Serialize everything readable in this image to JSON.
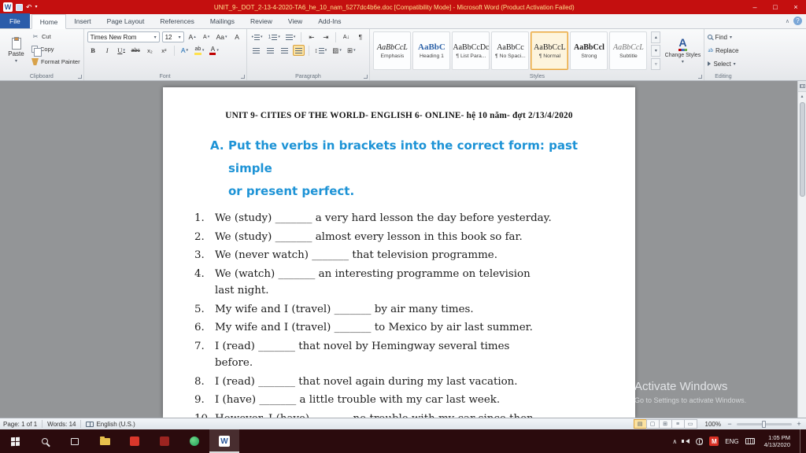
{
  "colors": {
    "titlebar": "#c40f0f",
    "taskbar": "#2b0b0d",
    "heading_blue": "#1d93d6",
    "file_tab_blue": "#2a5caa",
    "selection_orange": "#e8a33d",
    "doc_background": "#939597"
  },
  "icons": {
    "dropdown": "▾",
    "up_arrow": "▴",
    "down_arrow": "▾",
    "more_styles": "▿",
    "undo": "↶",
    "minimize": "–",
    "maximize": "□",
    "close": "×",
    "scissors": "✂",
    "pilcrow": "¶",
    "line_spacing": "↕",
    "shading": "▨",
    "borders": "⊞",
    "indent_decrease": "⇤",
    "indent_increase": "⇥",
    "sort": "A↓",
    "chevron_up": "∧",
    "help": "?",
    "view_print": "▤",
    "view_fullscreen": "▢",
    "view_web": "⊞",
    "view_outline": "≡",
    "view_draft": "▭",
    "zoom_out": "−",
    "zoom_in": "+",
    "spell_check": "✓"
  },
  "titlebar": {
    "title": "UNIT_9-_DOT_2-13-4-2020-TA6_he_10_nam_5277dc4b6e.doc [Compatibility Mode] - Microsoft Word (Product Activation Failed)"
  },
  "ribbon": {
    "tabs": [
      {
        "label": "File",
        "cls": "file"
      },
      {
        "label": "Home",
        "cls": "active"
      },
      {
        "label": "Insert"
      },
      {
        "label": "Page Layout"
      },
      {
        "label": "References"
      },
      {
        "label": "Mailings"
      },
      {
        "label": "Review"
      },
      {
        "label": "View"
      },
      {
        "label": "Add-Ins"
      }
    ],
    "clipboard": {
      "group_label": "Clipboard",
      "paste": "Paste",
      "cut": "Cut",
      "copy": "Copy",
      "format_painter": "Format Painter"
    },
    "font": {
      "group_label": "Font",
      "family": "Times New Rom",
      "size": "12",
      "grow": "A",
      "shrink": "A",
      "change_case": "Aa",
      "clear_formatting": "A",
      "bold": "B",
      "italic": "I",
      "underline": "U",
      "strike": "abc",
      "subscript": "x₂",
      "superscript": "x²",
      "effects": "A",
      "highlight": "ab",
      "font_color": "A"
    },
    "paragraph": {
      "group_label": "Paragraph"
    },
    "styles": {
      "group_label": "Styles",
      "gallery": [
        {
          "preview": "AaBbCcL",
          "name": "Emphasis",
          "cls": "italic"
        },
        {
          "preview": "AaBbC",
          "name": "Heading 1",
          "cls": "heading"
        },
        {
          "preview": "AaBbCcDc",
          "name": "¶ List Para..."
        },
        {
          "preview": "AaBbCc",
          "name": "¶ No Spaci..."
        },
        {
          "preview": "AaBbCcL",
          "name": "¶ Normal",
          "cls": "selected"
        },
        {
          "preview": "AaBbCcl",
          "name": "Strong",
          "cls": "bold"
        },
        {
          "preview": "AaBbCcL",
          "name": "Subtitle",
          "cls": "subtitle"
        }
      ],
      "change_styles": "Change Styles"
    },
    "editing": {
      "group_label": "Editing",
      "find": "Find",
      "replace": "Replace",
      "select": "Select"
    }
  },
  "document": {
    "header": "UNIT 9- CITIES OF THE WORLD- ENGLISH 6- ONLINE- hệ 10 năm- đợt 2/13/4/2020",
    "exercise": {
      "letter": "A.",
      "heading_line1": "Put the verbs in brackets into the correct form: past simple",
      "heading_line2": "or present perfect.",
      "items": [
        {
          "num": "1.",
          "lines": [
            "We (study) _______ a very hard lesson the day before yesterday."
          ]
        },
        {
          "num": "2.",
          "lines": [
            "We (study) _______ almost every lesson in this book so far."
          ]
        },
        {
          "num": "3.",
          "lines": [
            "We (never watch) _______ that television programme."
          ]
        },
        {
          "num": "4.",
          "lines": [
            "We (watch) _______ an interesting programme on television",
            "last night."
          ]
        },
        {
          "num": "5.",
          "lines": [
            "My wife and I (travel) _______ by air many times."
          ]
        },
        {
          "num": "6.",
          "lines": [
            "My wife and I (travel) _______ to Mexico by air last summer."
          ]
        },
        {
          "num": "7.",
          "lines": [
            "I (read) _______ that novel by Hemingway several times",
            "before."
          ]
        },
        {
          "num": "8.",
          "lines": [
            "I (read) _______ that novel again during my last vacation."
          ]
        },
        {
          "num": "9.",
          "lines": [
            "I (have) _______ a little trouble with my car last week."
          ]
        },
        {
          "num": "10.",
          "lines": [
            "However, I (have) _______ no trouble with my car since then."
          ]
        }
      ]
    }
  },
  "watermark": {
    "line1": "Activate Windows",
    "line2": "Go to Settings to activate Windows."
  },
  "statusbar": {
    "page": "Page: 1 of 1",
    "words": "Words: 14",
    "language": "English (U.S.)",
    "zoom": "100%"
  },
  "taskbar": {
    "lang": "ENG",
    "badge": "M",
    "time": "1:05 PM",
    "date": "4/13/2020"
  }
}
